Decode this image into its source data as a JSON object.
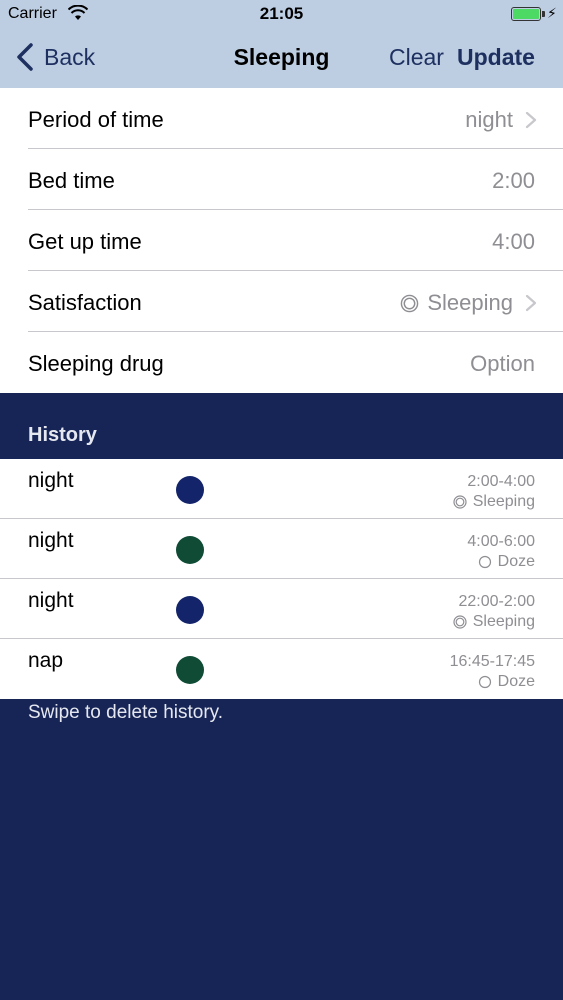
{
  "status_bar": {
    "carrier": "Carrier",
    "time": "21:05"
  },
  "nav": {
    "back_label": "Back",
    "title": "Sleeping",
    "clear_label": "Clear",
    "update_label": "Update"
  },
  "form": {
    "rows": [
      {
        "label": "Period of time",
        "value": "night"
      },
      {
        "label": "Bed time",
        "value": "2:00"
      },
      {
        "label": "Get up time",
        "value": "4:00"
      },
      {
        "label": "Satisfaction",
        "value": "Sleeping"
      },
      {
        "label": "Sleeping drug",
        "value": "Option"
      }
    ]
  },
  "history": {
    "header": "History",
    "items": [
      {
        "period": "night",
        "time": "2:00-4:00",
        "status": "Sleeping",
        "dot_color": "#13246b"
      },
      {
        "period": "night",
        "time": "4:00-6:00",
        "status": "Doze",
        "dot_color": "#0f4b35"
      },
      {
        "period": "night",
        "time": "22:00-2:00",
        "status": "Sleeping",
        "dot_color": "#13246b"
      },
      {
        "period": "nap",
        "time": "16:45-17:45",
        "status": "Doze",
        "dot_color": "#0f4b35"
      }
    ],
    "footer": "Swipe to delete history."
  },
  "colors": {
    "header_bg": "#bdcde2",
    "background": "#172556",
    "accent": "#1d3060"
  }
}
